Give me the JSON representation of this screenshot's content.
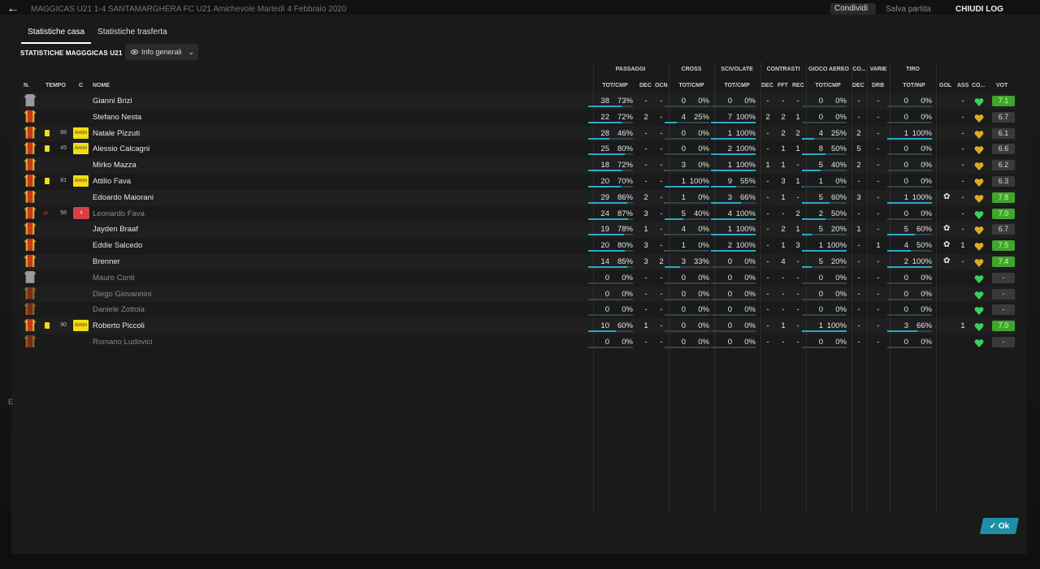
{
  "window": {
    "title": "MAGGICAS U21  1-4  SANTAMARGHERA FC U21   Amichevole   Martedì 4 Febbraio 2020",
    "share_label": "Condividi",
    "save_label": "Salva partita",
    "continue_label": "CHIUDI LOG"
  },
  "tabs": [
    {
      "label": "Statistiche casa",
      "active": true
    },
    {
      "label": "Statistiche trasferta",
      "active": false
    }
  ],
  "team_label": "STATISTICHE MAGGGICAS U21",
  "view_dropdown": {
    "label": "Info generali"
  },
  "group_headers": {
    "passaggi": "PASSAGGI",
    "cross": "CROSS",
    "scivolate": "SCIVOLATE",
    "contrasti": "CONTRASTI",
    "gioco_aereo": "GIOCO AEREO",
    "co": "CO...",
    "varie": "VARIE",
    "tiro": "TIRO"
  },
  "columns": {
    "n": "N.",
    "tempo": "TEMPO",
    "c": "C",
    "nome": "NOME",
    "pass_tot": "TOT/CMP",
    "pass_dec": "DEC",
    "pass_ocn": "OCN",
    "cross_tot": "TOT/CMP",
    "sciv_tot": "TOT/CMP",
    "con_dec": "DEC",
    "con_fft": "FFT",
    "con_rec": "REC",
    "aer_tot": "TOT/CMP",
    "co_dec": "DEC",
    "drb": "DRB",
    "tiro_tot": "TOT/INP",
    "gol": "GOL",
    "ass": "ASS",
    "co": "CO...",
    "vot": "VOT"
  },
  "players": [
    {
      "shirt": "gk",
      "card": "",
      "min": "",
      "badge": "",
      "name": "Gianni Brizi",
      "dim": false,
      "p": [
        "38",
        "73%"
      ],
      "pd": "-",
      "po": "-",
      "cr": [
        "0",
        "0%"
      ],
      "sc": [
        "0",
        "0%"
      ],
      "cd": "-",
      "cf": "-",
      "crc": "-",
      "ae": [
        "0",
        "0%"
      ],
      "aed": "-",
      "drb": "-",
      "ti": [
        "0",
        "0%"
      ],
      "gol": "",
      "ass": "-",
      "heart": "green",
      "vot": "7.1",
      "vcol": "green"
    },
    {
      "shirt": "out",
      "card": "",
      "min": "",
      "badge": "",
      "name": "Stefano Nesta",
      "dim": false,
      "p": [
        "22",
        "72%"
      ],
      "pd": "2",
      "po": "-",
      "cr": [
        "4",
        "25%"
      ],
      "sc": [
        "7",
        "100%"
      ],
      "cd": "2",
      "cf": "2",
      "crc": "1",
      "ae": [
        "0",
        "0%"
      ],
      "aed": "-",
      "drb": "-",
      "ti": [
        "0",
        "0%"
      ],
      "gol": "",
      "ass": "-",
      "heart": "gold",
      "vot": "6.7",
      "vcol": "grey"
    },
    {
      "shirt": "out",
      "card": "y",
      "min": "88",
      "badge": "Amm",
      "name": "Natale Pizzuti",
      "dim": false,
      "p": [
        "28",
        "46%"
      ],
      "pd": "-",
      "po": "-",
      "cr": [
        "0",
        "0%"
      ],
      "sc": [
        "1",
        "100%"
      ],
      "cd": "-",
      "cf": "2",
      "crc": "2",
      "ae": [
        "4",
        "25%"
      ],
      "aed": "2",
      "drb": "-",
      "ti": [
        "1",
        "100%"
      ],
      "gol": "",
      "ass": "-",
      "heart": "gold",
      "vot": "6.1",
      "vcol": "grey"
    },
    {
      "shirt": "out",
      "card": "y",
      "min": "45",
      "badge": "Amm",
      "name": "Alessio Calcagni",
      "dim": false,
      "p": [
        "25",
        "80%"
      ],
      "pd": "-",
      "po": "-",
      "cr": [
        "0",
        "0%"
      ],
      "sc": [
        "2",
        "100%"
      ],
      "cd": "-",
      "cf": "1",
      "crc": "1",
      "ae": [
        "8",
        "50%"
      ],
      "aed": "5",
      "drb": "-",
      "ti": [
        "0",
        "0%"
      ],
      "gol": "",
      "ass": "-",
      "heart": "gold",
      "vot": "6.6",
      "vcol": "grey"
    },
    {
      "shirt": "out",
      "card": "",
      "min": "",
      "badge": "",
      "name": "Mirko Mazza",
      "dim": false,
      "p": [
        "18",
        "72%"
      ],
      "pd": "-",
      "po": "-",
      "cr": [
        "3",
        "0%"
      ],
      "sc": [
        "1",
        "100%"
      ],
      "cd": "1",
      "cf": "1",
      "crc": "-",
      "ae": [
        "5",
        "40%"
      ],
      "aed": "2",
      "drb": "-",
      "ti": [
        "0",
        "0%"
      ],
      "gol": "",
      "ass": "-",
      "heart": "gold",
      "vot": "6.2",
      "vcol": "grey"
    },
    {
      "shirt": "out",
      "card": "y",
      "min": "81",
      "badge": "Amm",
      "name": "Attilio Fava",
      "dim": false,
      "p": [
        "20",
        "70%"
      ],
      "pd": "-",
      "po": "-",
      "cr": [
        "1",
        "100%"
      ],
      "sc": [
        "9",
        "55%"
      ],
      "cd": "-",
      "cf": "3",
      "crc": "1",
      "ae": [
        "1",
        "0%"
      ],
      "aed": "-",
      "drb": "-",
      "ti": [
        "0",
        "0%"
      ],
      "gol": "",
      "ass": "-",
      "heart": "gold",
      "vot": "6.3",
      "vcol": "grey"
    },
    {
      "shirt": "out",
      "card": "",
      "min": "",
      "badge": "",
      "name": "Edoardo Maiorani",
      "dim": false,
      "p": [
        "29",
        "86%"
      ],
      "pd": "2",
      "po": "-",
      "cr": [
        "1",
        "0%"
      ],
      "sc": [
        "3",
        "66%"
      ],
      "cd": "-",
      "cf": "1",
      "crc": "-",
      "ae": [
        "5",
        "60%"
      ],
      "aed": "3",
      "drb": "-",
      "ti": [
        "1",
        "100%"
      ],
      "gol": "ball",
      "ass": "-",
      "heart": "gold",
      "vot": "7.8",
      "vcol": "green"
    },
    {
      "shirt": "out",
      "card": "sub",
      "min": "56",
      "badge": "out",
      "name": "Leonardo Fava",
      "dim": true,
      "p": [
        "24",
        "87%"
      ],
      "pd": "3",
      "po": "-",
      "cr": [
        "5",
        "40%"
      ],
      "sc": [
        "4",
        "100%"
      ],
      "cd": "-",
      "cf": "-",
      "crc": "2",
      "ae": [
        "2",
        "50%"
      ],
      "aed": "-",
      "drb": "-",
      "ti": [
        "0",
        "0%"
      ],
      "gol": "",
      "ass": "-",
      "heart": "green",
      "vot": "7.0",
      "vcol": "green"
    },
    {
      "shirt": "out",
      "card": "",
      "min": "",
      "badge": "",
      "name": "Jayden Braaf",
      "dim": false,
      "p": [
        "19",
        "78%"
      ],
      "pd": "1",
      "po": "-",
      "cr": [
        "4",
        "0%"
      ],
      "sc": [
        "1",
        "100%"
      ],
      "cd": "-",
      "cf": "2",
      "crc": "1",
      "ae": [
        "5",
        "20%"
      ],
      "aed": "1",
      "drb": "-",
      "ti": [
        "5",
        "60%"
      ],
      "gol": "ball",
      "ass": "-",
      "heart": "gold",
      "vot": "6.7",
      "vcol": "grey"
    },
    {
      "shirt": "out",
      "card": "",
      "min": "",
      "badge": "",
      "name": "Eddie Salcedo",
      "dim": false,
      "p": [
        "20",
        "80%"
      ],
      "pd": "3",
      "po": "-",
      "cr": [
        "1",
        "0%"
      ],
      "sc": [
        "2",
        "100%"
      ],
      "cd": "-",
      "cf": "1",
      "crc": "3",
      "ae": [
        "1",
        "100%"
      ],
      "aed": "-",
      "drb": "1",
      "ti": [
        "4",
        "50%"
      ],
      "gol": "ball",
      "ass": "1",
      "heart": "gold",
      "vot": "7.5",
      "vcol": "green"
    },
    {
      "shirt": "out",
      "card": "",
      "min": "",
      "badge": "",
      "name": "Brenner",
      "dim": false,
      "p": [
        "14",
        "85%"
      ],
      "pd": "3",
      "po": "2",
      "cr": [
        "3",
        "33%"
      ],
      "sc": [
        "0",
        "0%"
      ],
      "cd": "-",
      "cf": "4",
      "crc": "-",
      "ae": [
        "5",
        "20%"
      ],
      "aed": "-",
      "drb": "-",
      "ti": [
        "2",
        "100%"
      ],
      "gol": "ball",
      "ass": "-",
      "heart": "gold",
      "vot": "7.4",
      "vcol": "green"
    },
    {
      "shirt": "gk",
      "card": "",
      "min": "",
      "badge": "",
      "name": "Mauro Conti",
      "dim": true,
      "p": [
        "0",
        "0%"
      ],
      "pd": "-",
      "po": "-",
      "cr": [
        "0",
        "0%"
      ],
      "sc": [
        "0",
        "0%"
      ],
      "cd": "-",
      "cf": "-",
      "crc": "-",
      "ae": [
        "0",
        "0%"
      ],
      "aed": "-",
      "drb": "-",
      "ti": [
        "0",
        "0%"
      ],
      "gol": "",
      "ass": "",
      "heart": "green",
      "vot": "-",
      "vcol": "grey"
    },
    {
      "shirt": "sub",
      "card": "",
      "min": "",
      "badge": "",
      "name": "Diego Giovannini",
      "dim": true,
      "p": [
        "0",
        "0%"
      ],
      "pd": "-",
      "po": "-",
      "cr": [
        "0",
        "0%"
      ],
      "sc": [
        "0",
        "0%"
      ],
      "cd": "-",
      "cf": "-",
      "crc": "-",
      "ae": [
        "0",
        "0%"
      ],
      "aed": "-",
      "drb": "-",
      "ti": [
        "0",
        "0%"
      ],
      "gol": "",
      "ass": "",
      "heart": "green",
      "vot": "-",
      "vcol": "grey"
    },
    {
      "shirt": "sub",
      "card": "",
      "min": "",
      "badge": "",
      "name": "Daniele Zottola",
      "dim": true,
      "p": [
        "0",
        "0%"
      ],
      "pd": "-",
      "po": "-",
      "cr": [
        "0",
        "0%"
      ],
      "sc": [
        "0",
        "0%"
      ],
      "cd": "-",
      "cf": "-",
      "crc": "-",
      "ae": [
        "0",
        "0%"
      ],
      "aed": "-",
      "drb": "-",
      "ti": [
        "0",
        "0%"
      ],
      "gol": "",
      "ass": "",
      "heart": "green",
      "vot": "-",
      "vcol": "grey"
    },
    {
      "shirt": "out",
      "card": "y",
      "min": "90",
      "badge": "Amm",
      "name": "Roberto Piccoli",
      "dim": false,
      "p": [
        "10",
        "60%"
      ],
      "pd": "1",
      "po": "-",
      "cr": [
        "0",
        "0%"
      ],
      "sc": [
        "0",
        "0%"
      ],
      "cd": "-",
      "cf": "1",
      "crc": "-",
      "ae": [
        "1",
        "100%"
      ],
      "aed": "-",
      "drb": "-",
      "ti": [
        "3",
        "66%"
      ],
      "gol": "",
      "ass": "1",
      "heart": "green",
      "vot": "7.0",
      "vcol": "green"
    },
    {
      "shirt": "sub",
      "card": "",
      "min": "",
      "badge": "",
      "name": "Romano Ludovici",
      "dim": true,
      "p": [
        "0",
        "0%"
      ],
      "pd": "-",
      "po": "-",
      "cr": [
        "0",
        "0%"
      ],
      "sc": [
        "0",
        "0%"
      ],
      "cd": "-",
      "cf": "-",
      "crc": "-",
      "ae": [
        "0",
        "0%"
      ],
      "aed": "-",
      "drb": "-",
      "ti": [
        "0",
        "0%"
      ],
      "gol": "",
      "ass": "",
      "heart": "green",
      "vot": "-",
      "vcol": "grey"
    }
  ],
  "ok_label": "Ok",
  "side_mark": "E",
  "colors": {
    "accent": "#2aa9c7",
    "vote_green": "#3fa52f",
    "amm_yellow": "#f2dc12",
    "red_card": "#d64045"
  }
}
